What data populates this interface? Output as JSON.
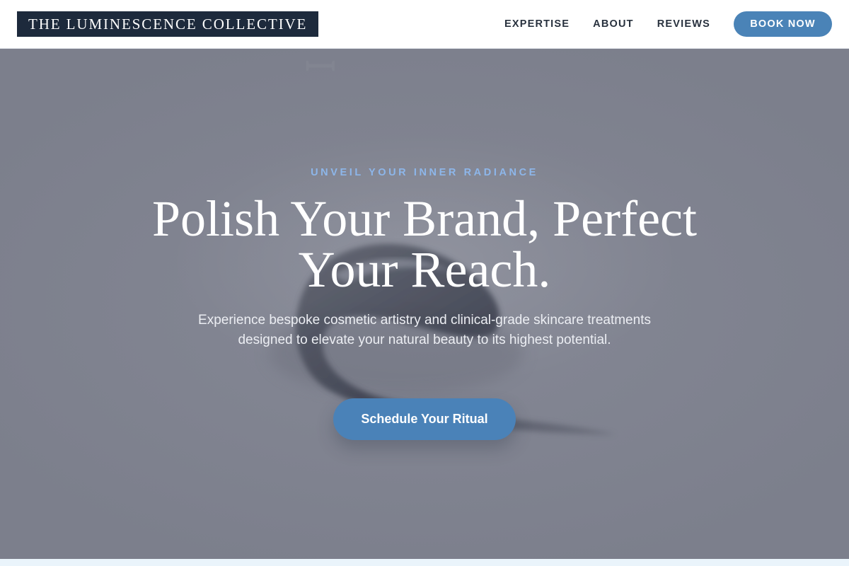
{
  "header": {
    "logo_text": "THE LUMINESCENCE COLLECTIVE",
    "nav": [
      {
        "label": "EXPERTISE"
      },
      {
        "label": "ABOUT"
      },
      {
        "label": "REVIEWS"
      }
    ],
    "book_label": "BOOK NOW"
  },
  "hero": {
    "eyebrow": "UNVEIL YOUR INNER RADIANCE",
    "headline_line1": "Polish Your Brand, Perfect",
    "headline_line2": "Your Reach.",
    "subtext": "Experience bespoke cosmetic artistry and clinical-grade skincare treatments designed to elevate your natural beauty to its highest potential.",
    "cta_label": "Schedule Your Ritual"
  },
  "colors": {
    "header_bg": "#ffffff",
    "logo_bg": "#1d2a3c",
    "accent": "#4a83b7",
    "hero_overlay": "#7e818e",
    "eyebrow": "#8db6ea"
  }
}
